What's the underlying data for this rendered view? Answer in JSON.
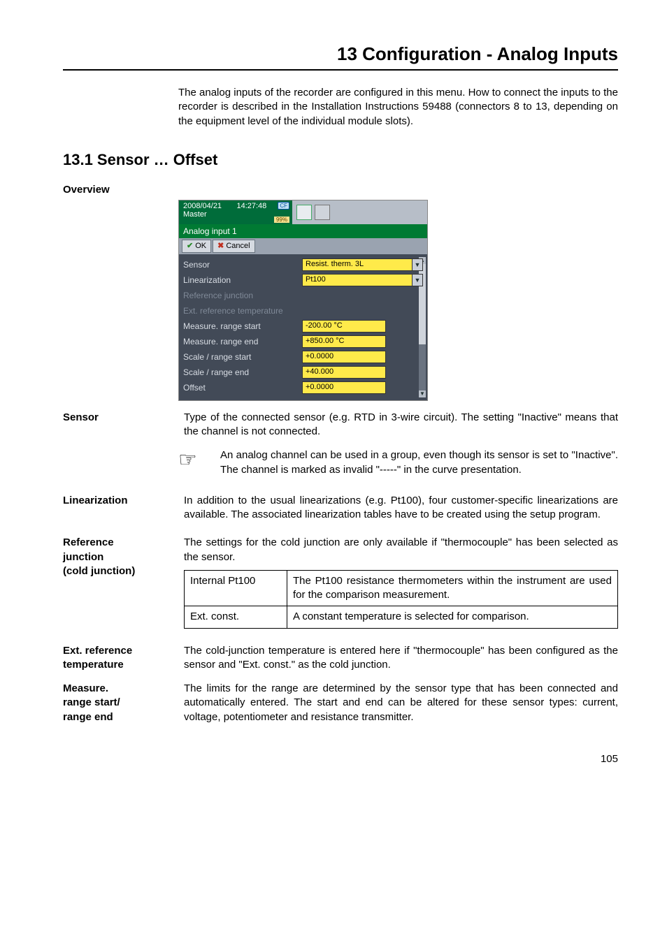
{
  "title": "13 Configuration - Analog Inputs",
  "intro": "The analog inputs of the recorder are configured in this menu. How to connect the inputs to the recorder is described in the Installation Instructions 59488 (connectors 8 to 13, depending on the equipment level of the individual module slots).",
  "section_heading": "13.1   Sensor … Offset",
  "overview_label": "Overview",
  "screenshot": {
    "date": "2008/04/21",
    "time": "14:27:48",
    "master": "Master",
    "pct": "99%",
    "cf": "CF",
    "header": "Analog input 1",
    "ok": "OK",
    "cancel": "Cancel",
    "rows": {
      "sensor_lbl": "Sensor",
      "sensor_val": "Resist. therm. 3L",
      "lin_lbl": "Linearization",
      "lin_val": "Pt100",
      "refj_lbl": "Reference junction",
      "extref_lbl": "Ext. reference temperature",
      "mrs_lbl": "Measure. range start",
      "mrs_val": "-200.00 °C",
      "mre_lbl": "Measure. range end",
      "mre_val": "+850.00 °C",
      "srs_lbl": "Scale / range start",
      "srs_val": "+0.0000",
      "sre_lbl": "Scale / range end",
      "sre_val": "+40.000",
      "off_lbl": "Offset",
      "off_val": "+0.0000"
    }
  },
  "sensor": {
    "label": "Sensor",
    "text": "Type of the connected sensor (e.g. RTD in 3-wire circuit). The setting \"Inactive\" means that the channel is not connected.",
    "note": "An analog channel can be used in a group, even though its sensor is set to \"Inactive\". The channel is marked as invalid \"-----\" in the curve presentation."
  },
  "linearization": {
    "label": "Linearization",
    "text": "In addition to the usual linearizations (e.g. Pt100), four customer-specific linearizations are available. The associated linearization tables have to be created using the setup program."
  },
  "refjunction": {
    "label1": "Reference",
    "label2": "junction",
    "label3": "(cold junction)",
    "text": "The settings for the cold junction are only available if \"thermocouple\" has been selected as the sensor.",
    "table": {
      "r1c1": "Internal Pt100",
      "r1c2": "The Pt100 resistance thermometers within the instrument are used for the comparison measurement.",
      "r2c1": "Ext. const.",
      "r2c2": "A constant temperature is selected for comparison."
    }
  },
  "extref": {
    "label1": "Ext. reference",
    "label2": "temperature",
    "text": "The cold-junction temperature is entered here if  \"thermocouple\" has been configured as the sensor and \"Ext. const.\" as the cold junction."
  },
  "measure": {
    "label1": "Measure.",
    "label2": "range start/",
    "label3": "range end",
    "text": "The limits for the range are determined by the sensor type that has been connected and automatically entered. The start and end can be altered for these sensor types: current, voltage, potentiometer and resistance transmitter."
  },
  "page_number": "105"
}
